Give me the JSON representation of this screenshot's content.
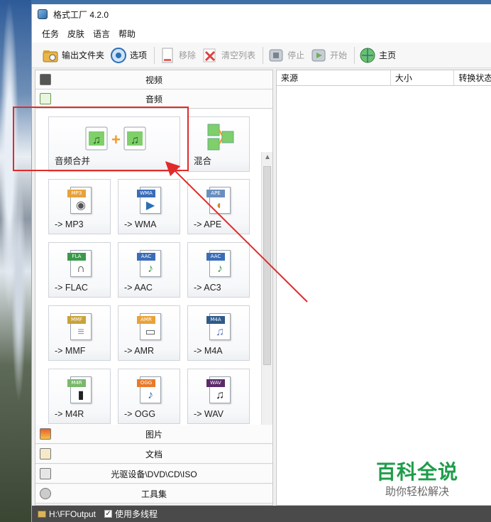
{
  "window": {
    "title": "格式工厂 4.2.0"
  },
  "menu": [
    "任务",
    "皮肤",
    "语言",
    "帮助"
  ],
  "toolbar": {
    "output_folder": "输出文件夹",
    "options": "选项",
    "remove": "移除",
    "clear_list": "清空列表",
    "stop": "停止",
    "start": "开始",
    "home": "主页"
  },
  "categories": {
    "video": "视频",
    "audio": "音频",
    "image": "图片",
    "document": "文档",
    "optical": "光驱设备\\DVD\\CD\\ISO",
    "tools": "工具集"
  },
  "tiles": [
    {
      "label": "音频合并",
      "tag": ""
    },
    {
      "label": "混合",
      "tag": ""
    },
    {
      "label": "-> MP3",
      "tag": "MP3"
    },
    {
      "label": "-> WMA",
      "tag": "WMA"
    },
    {
      "label": "-> APE",
      "tag": "APE"
    },
    {
      "label": "-> FLAC",
      "tag": "FLA"
    },
    {
      "label": "-> AAC",
      "tag": "AAC"
    },
    {
      "label": "-> AC3",
      "tag": "AAC"
    },
    {
      "label": "-> MMF",
      "tag": "MMF"
    },
    {
      "label": "-> AMR",
      "tag": "AMR"
    },
    {
      "label": "-> M4A",
      "tag": "M4A"
    },
    {
      "label": "-> M4R",
      "tag": "M4R"
    },
    {
      "label": "-> OGG",
      "tag": "OGG"
    },
    {
      "label": "-> WAV",
      "tag": "WAV"
    }
  ],
  "table": {
    "columns": [
      "来源",
      "大小",
      "转换状态"
    ]
  },
  "status": {
    "path": "H:\\FFOutput",
    "multithread": "使用多线程"
  },
  "watermark": {
    "title": "百科全说",
    "subtitle": "助你轻松解决"
  }
}
